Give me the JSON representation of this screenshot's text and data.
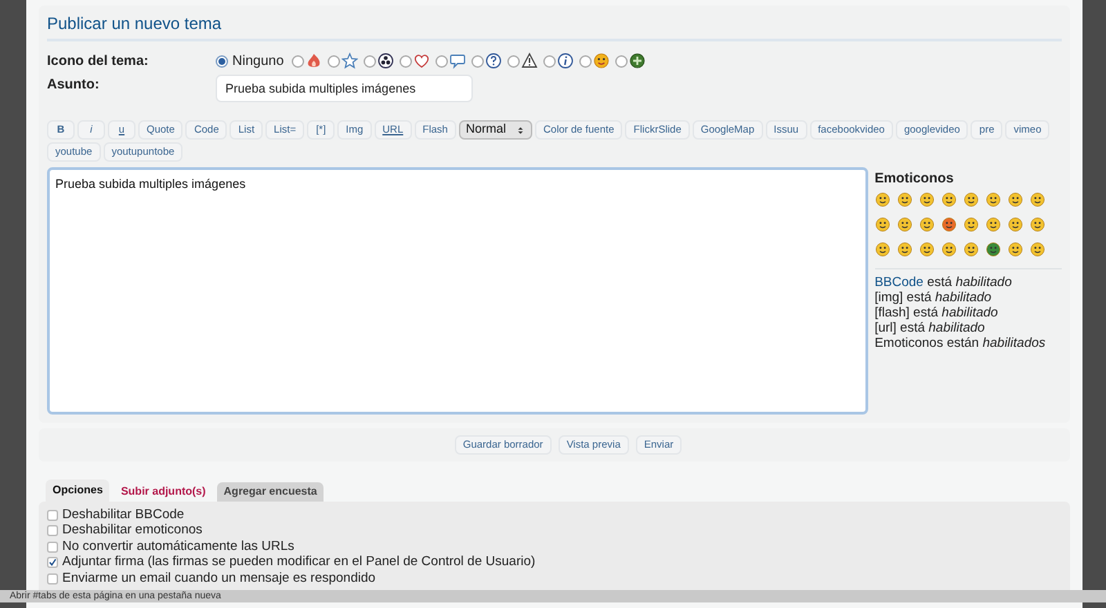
{
  "heading": "Publicar un nuevo tema",
  "topic_icon": {
    "label": "Icono del tema:",
    "options": [
      {
        "kind": "none",
        "label": "Ninguno",
        "selected": true
      },
      {
        "kind": "flame",
        "selected": false
      },
      {
        "kind": "star",
        "selected": false
      },
      {
        "kind": "radioactive",
        "selected": false
      },
      {
        "kind": "heart",
        "selected": false
      },
      {
        "kind": "bubble",
        "selected": false
      },
      {
        "kind": "question",
        "selected": false
      },
      {
        "kind": "warning",
        "selected": false
      },
      {
        "kind": "info",
        "selected": false
      },
      {
        "kind": "smiley",
        "selected": false
      },
      {
        "kind": "green",
        "selected": false
      }
    ]
  },
  "subject": {
    "label": "Asunto:",
    "value": "Prueba subida multiples imágenes"
  },
  "toolbar": [
    {
      "kind": "button",
      "label": "B"
    },
    {
      "kind": "button",
      "label": "i"
    },
    {
      "kind": "button",
      "label": "u"
    },
    {
      "kind": "button",
      "label": "Quote"
    },
    {
      "kind": "button",
      "label": "Code"
    },
    {
      "kind": "button",
      "label": "List"
    },
    {
      "kind": "button",
      "label": "List="
    },
    {
      "kind": "button",
      "label": "[*]"
    },
    {
      "kind": "button",
      "label": "Img"
    },
    {
      "kind": "button",
      "label": "URL"
    },
    {
      "kind": "button",
      "label": "Flash"
    },
    {
      "kind": "select",
      "label": "Normal"
    },
    {
      "kind": "button",
      "label": "Color de fuente"
    },
    {
      "kind": "button",
      "label": "FlickrSlide"
    },
    {
      "kind": "button",
      "label": "GoogleMap"
    },
    {
      "kind": "button",
      "label": "Issuu"
    },
    {
      "kind": "button",
      "label": "facebookvideo"
    },
    {
      "kind": "button",
      "label": "googlevideo"
    },
    {
      "kind": "button",
      "label": "pre"
    },
    {
      "kind": "button",
      "label": "vimeo"
    },
    {
      "kind": "button",
      "label": "youtube"
    },
    {
      "kind": "button",
      "label": "youtupuntobe"
    }
  ],
  "message": "Prueba subida multiples imágenes",
  "emoticons": {
    "title": "Emoticonos",
    "items": [
      {
        "color": "#f2c230"
      },
      {
        "color": "#f2c230"
      },
      {
        "color": "#f2c230"
      },
      {
        "color": "#f2c230"
      },
      {
        "color": "#f2c230"
      },
      {
        "color": "#f2c230"
      },
      {
        "color": "#f2c230"
      },
      {
        "color": "#f2c230"
      },
      {
        "color": "#f2c230"
      },
      {
        "color": "#f2c230"
      },
      {
        "color": "#f2c230"
      },
      {
        "color": "#e86a2a"
      },
      {
        "color": "#f2c230"
      },
      {
        "color": "#f2c230"
      },
      {
        "color": "#f2c230"
      },
      {
        "color": "#f2c230"
      },
      {
        "color": "#f2c230"
      },
      {
        "color": "#f2c230"
      },
      {
        "color": "#f2c230"
      },
      {
        "color": "#f2c230"
      },
      {
        "color": "#f2c230"
      },
      {
        "color": "#3a8a3a"
      },
      {
        "color": "#f2c230"
      },
      {
        "color": "#f2c230"
      }
    ]
  },
  "status_lines": [
    {
      "link": "BBCode",
      "text": " está *habilitado*"
    },
    {
      "text": "[img] está *habilitado*"
    },
    {
      "text": "[flash] está *habilitado*"
    },
    {
      "text": "[url] está *habilitado*"
    },
    {
      "text": "Emoticonos están *habilitados*"
    }
  ],
  "actions": [
    "Guardar borrador",
    "Vista previa",
    "Enviar"
  ],
  "tabs": [
    {
      "label": "Opciones",
      "selected": true,
      "highlight": false
    },
    {
      "label": "Subir adjunto(s)",
      "selected": false,
      "highlight": true
    },
    {
      "label": "Agregar encuesta",
      "selected": false,
      "highlight": false
    }
  ],
  "options": [
    {
      "label": "Deshabilitar BBCode",
      "checked": false
    },
    {
      "label": "Deshabilitar emoticonos",
      "checked": false
    },
    {
      "label": "No convertir automáticamente las URLs",
      "checked": false
    },
    {
      "label": "Adjuntar firma (las firmas se pueden modificar en el Panel de Control de Usuario)",
      "checked": true
    },
    {
      "label": "Enviarme un email cuando un mensaje es respondido",
      "checked": false
    }
  ],
  "status_bar": "Abrir #tabs de esta página en una pestaña nueva"
}
